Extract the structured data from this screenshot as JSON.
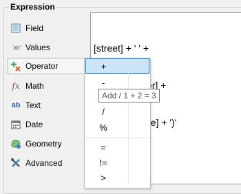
{
  "panel": {
    "title": "Expression"
  },
  "categories": [
    {
      "label": "Field",
      "icon": "field-icon"
    },
    {
      "label": "Values",
      "icon": "values-icon",
      "icon_text": "'ab'"
    },
    {
      "label": "Operator",
      "icon": "operator-icon",
      "selected": true
    },
    {
      "label": "Math",
      "icon": "math-icon",
      "icon_text": "fx"
    },
    {
      "label": "Text",
      "icon": "text-icon",
      "icon_text": "ab"
    },
    {
      "label": "Date",
      "icon": "date-icon"
    },
    {
      "label": "Geometry",
      "icon": "geometry-icon"
    },
    {
      "label": "Advanced",
      "icon": "advanced-icon"
    }
  ],
  "editor": {
    "lines": [
      "[street] + ' ' +",
      "[housenumber] +",
      "' (' + [postcode] + ')'"
    ]
  },
  "operators": [
    {
      "label": "+",
      "selected": true
    },
    {
      "label": "-"
    },
    {
      "label": "/"
    },
    {
      "label": "%"
    },
    {
      "label": "="
    },
    {
      "label": "!="
    },
    {
      "label": ">"
    }
  ],
  "tooltip": {
    "text": "Add / 1 + 2 = 3"
  },
  "colors": {
    "selection": "#cce4f7",
    "selection_border": "#0078d7"
  }
}
